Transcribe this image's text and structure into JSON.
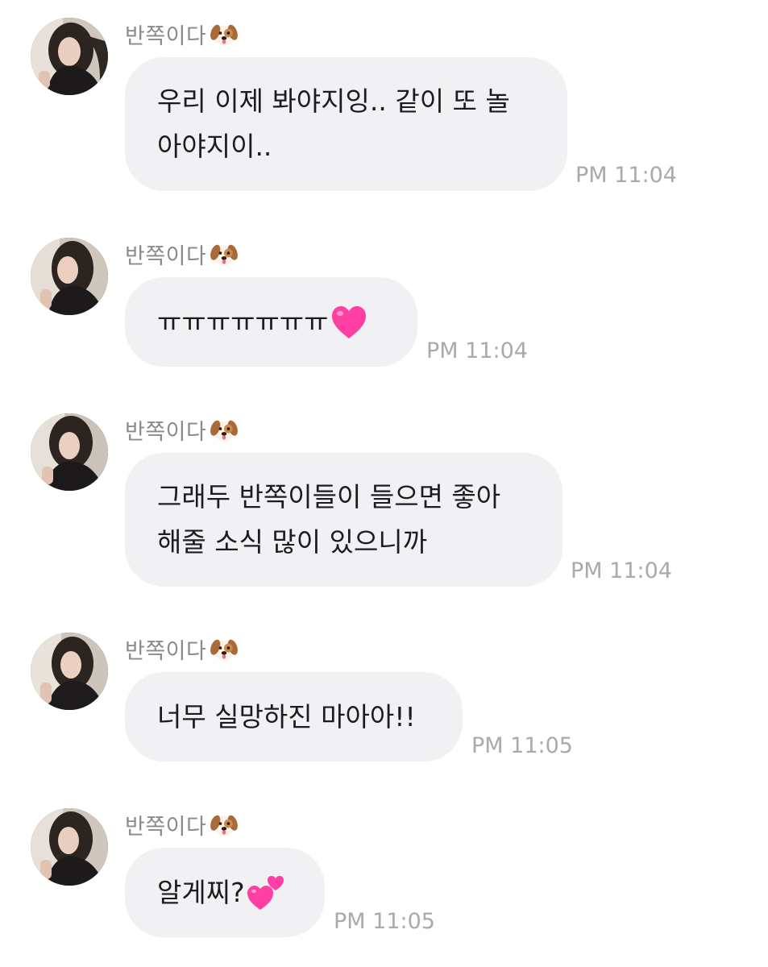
{
  "messages": [
    {
      "sender": "반쪽이다",
      "sender_emoji": "dog-face-icon",
      "text": "우리 이제 봐야지잉.. 같이 또 놀\n아야지이..",
      "trailing_emoji": null,
      "time": "PM 11:04"
    },
    {
      "sender": "반쪽이다",
      "sender_emoji": "dog-face-icon",
      "text": "ㅠㅠㅠㅠㅠㅠㅠ",
      "trailing_emoji": "pink-heart-icon",
      "time": "PM 11:04"
    },
    {
      "sender": "반쪽이다",
      "sender_emoji": "dog-face-icon",
      "text": "그래두 반쪽이들이 들으면 좋아\n해줄 소식 많이 있으니까",
      "trailing_emoji": null,
      "time": "PM 11:04"
    },
    {
      "sender": "반쪽이다",
      "sender_emoji": "dog-face-icon",
      "text": "너무 실망하진 마아아!!",
      "trailing_emoji": null,
      "time": "PM 11:05"
    },
    {
      "sender": "반쪽이다",
      "sender_emoji": "dog-face-icon",
      "text": "알게찌?",
      "trailing_emoji": "two-hearts-icon",
      "time": "PM 11:05"
    }
  ],
  "colors": {
    "bubble_background": "#f1f1f4",
    "message_text": "#1c1c1e",
    "sender_text": "#8a8a8e",
    "time_text": "#a9a9ae",
    "heart": "#ff3fa4"
  }
}
